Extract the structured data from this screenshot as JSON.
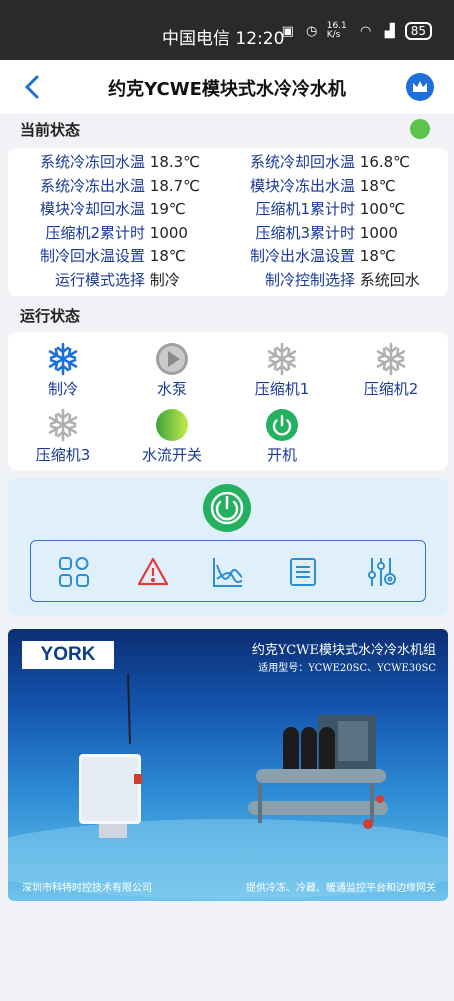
{
  "statusbar": {
    "carrier": "中国电信",
    "time": "12:20",
    "net_speed": "16.1 K/s",
    "battery": "85"
  },
  "header": {
    "title": "约克YCWE模块式水冷冷水机",
    "back_icon": "chevron-left-icon",
    "crown_icon": "crown-icon"
  },
  "current_status": {
    "title": "当前状态",
    "indicator_color": "#5cc34b",
    "rows": [
      {
        "l1": "系统冷冻回水温",
        "v1": "18.3℃",
        "l2": "系统冷却回水温",
        "v2": "16.8℃"
      },
      {
        "l1": "系统冷冻出水温",
        "v1": "18.7℃",
        "l2": "模块冷冻出水温",
        "v2": "18℃"
      },
      {
        "l1": "模块冷却回水温",
        "v1": "19℃",
        "l2": "压缩机1累计时",
        "v2": "100℃"
      },
      {
        "l1": "压缩机2累计时",
        "v1": "1000",
        "l2": "压缩机3累计时",
        "v2": "1000"
      },
      {
        "l1": "制冷回水温设置",
        "v1": "18℃",
        "l2": "制冷出水温设置",
        "v2": "18℃"
      },
      {
        "l1": "运行模式选择",
        "v1": "制冷",
        "l2": "制冷控制选择",
        "v2": "系统回水"
      }
    ]
  },
  "run_status": {
    "title": "运行状态",
    "items": [
      {
        "label": "制冷",
        "icon": "snowflake-icon",
        "color": "#1e6fd9"
      },
      {
        "label": "水泵",
        "icon": "pump-play-icon",
        "color": "#9a9a9a"
      },
      {
        "label": "压缩机1",
        "icon": "snowflake-icon",
        "color": "#b0b0b0"
      },
      {
        "label": "压缩机2",
        "icon": "snowflake-icon",
        "color": "#b0b0b0"
      },
      {
        "label": "压缩机3",
        "icon": "snowflake-icon",
        "color": "#b0b0b0"
      },
      {
        "label": "水流开关",
        "icon": "water-flow-icon",
        "color": "#5cc34b"
      },
      {
        "label": "开机",
        "icon": "power-icon",
        "color": "#23b15f"
      }
    ]
  },
  "controls": {
    "power_icon": "power-icon",
    "toolbar": [
      "grid-icon",
      "warning-icon",
      "chart-icon",
      "list-icon",
      "settings-sliders-icon"
    ],
    "accent": "#3a6fd0",
    "warning_color": "#e23a3a"
  },
  "banner": {
    "logo": "YORK",
    "title": "约克YCWE模块式水冷冷水机组",
    "subtitle": "适用型号：YCWE20SC、YCWE30SC",
    "footer_left": "深圳市科特时控技术有限公司",
    "footer_right": "提供冷冻、冷藏、暖通监控平台和边缘网关"
  }
}
